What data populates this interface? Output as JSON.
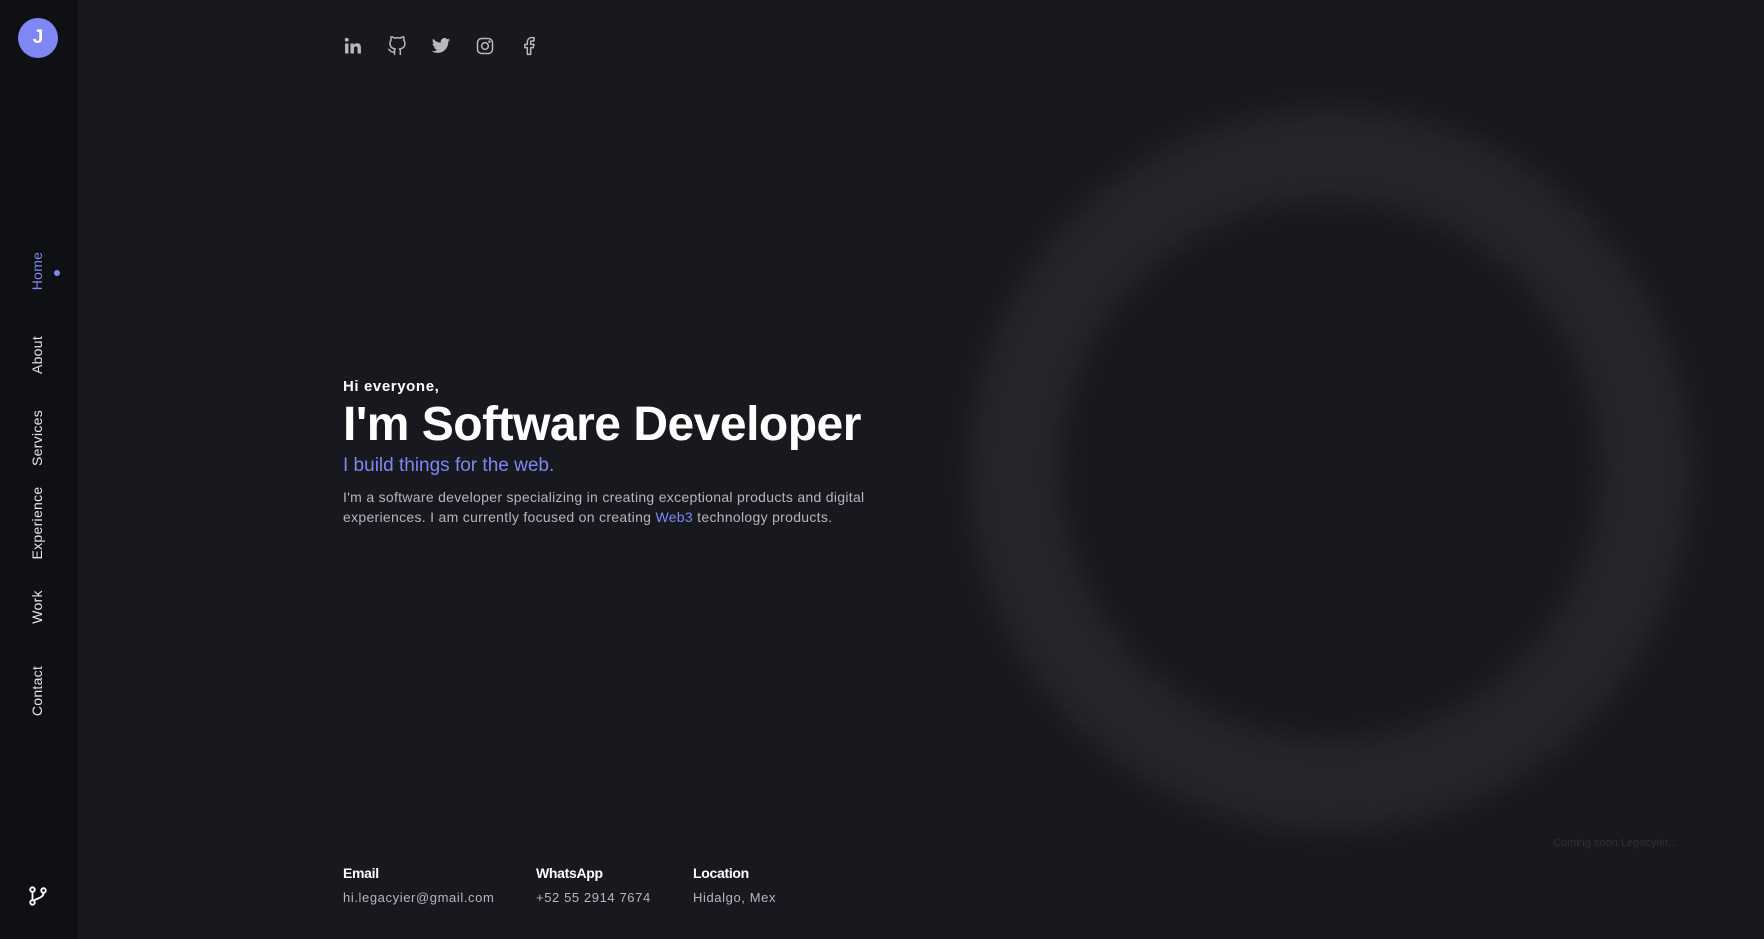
{
  "sidebar": {
    "avatar_initial": "J",
    "nav": [
      {
        "label": "Home",
        "active": true
      },
      {
        "label": "About",
        "active": false
      },
      {
        "label": "Services",
        "active": false
      },
      {
        "label": "Experience",
        "active": false
      },
      {
        "label": "Work",
        "active": false
      },
      {
        "label": "Contact",
        "active": false
      }
    ],
    "bottom_icon": "git-branch-icon"
  },
  "socials": [
    {
      "name": "linkedin-icon"
    },
    {
      "name": "github-icon"
    },
    {
      "name": "twitter-icon"
    },
    {
      "name": "instagram-icon"
    },
    {
      "name": "facebook-icon"
    }
  ],
  "hero": {
    "greeting": "Hi everyone,",
    "headline": "I'm Software Developer",
    "tagline": "I build things for the web.",
    "bio_part1": "I'm a software developer specializing in creating exceptional products and digital experiences. I am currently focused on creating ",
    "bio_highlight": "Web3",
    "bio_part2": " technology products."
  },
  "contact": {
    "email": {
      "label": "Email",
      "value": "hi.legacyier@gmail.com"
    },
    "whatsapp": {
      "label": "WhatsApp",
      "value": "+52 55 2914 7674"
    },
    "location": {
      "label": "Location",
      "value": "Hidalgo, Mex"
    }
  },
  "footer_note": "Coming soon Legacyier...",
  "colors": {
    "accent": "#7e87f3",
    "background": "#18191e",
    "sidebar": "#0f1014",
    "text": "#ffffff",
    "muted": "#b4b6be"
  }
}
